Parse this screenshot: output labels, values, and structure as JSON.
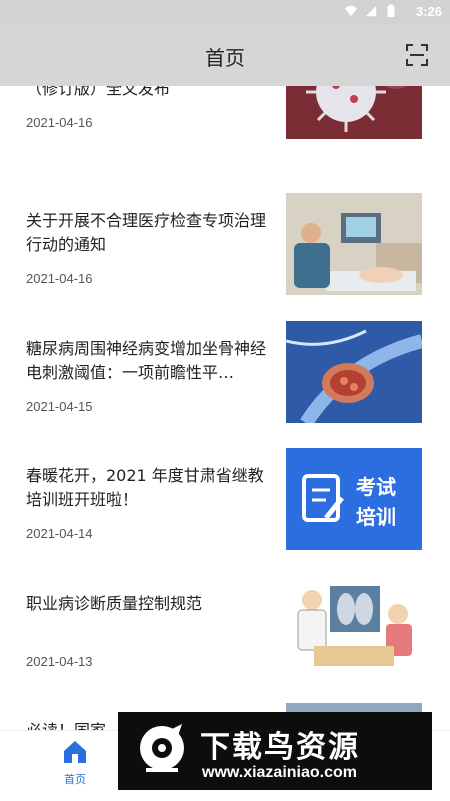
{
  "statusbar": {
    "time": "3:26"
  },
  "header": {
    "title": "首页"
  },
  "articles": [
    {
      "title": "最新！第八版新冠肺炎诊疗方案（修订版）全文发布",
      "date": "2021-04-16",
      "image": "virus-image"
    },
    {
      "title": "关于开展不合理医疗检查专项治理行动的通知",
      "date": "2021-04-16",
      "image": "ultrasound-image"
    },
    {
      "title": "糖尿病周围神经病变增加坐骨神经电刺激阈值：一项前瞻性平…",
      "date": "2021-04-15",
      "image": "nerve-image"
    },
    {
      "title": "春暖花开，2021 年度甘肃省继教培训班开班啦！",
      "date": "2021-04-14",
      "image": "exam-training-image",
      "image_text": [
        "考试",
        "培训"
      ]
    },
    {
      "title": "职业病诊断质量控制规范",
      "date": "2021-04-13",
      "image": "doctor-xray-image"
    },
    {
      "title": "必读！国家",
      "date": "",
      "image": "partial-image"
    }
  ],
  "tabbar": {
    "home_label": "首页"
  },
  "ad": {
    "headline": "下载鸟资源",
    "url": "www.xiazainiao.com"
  },
  "colors": {
    "header_bg": "#d6d6d6",
    "accent": "#2a6fe0"
  }
}
